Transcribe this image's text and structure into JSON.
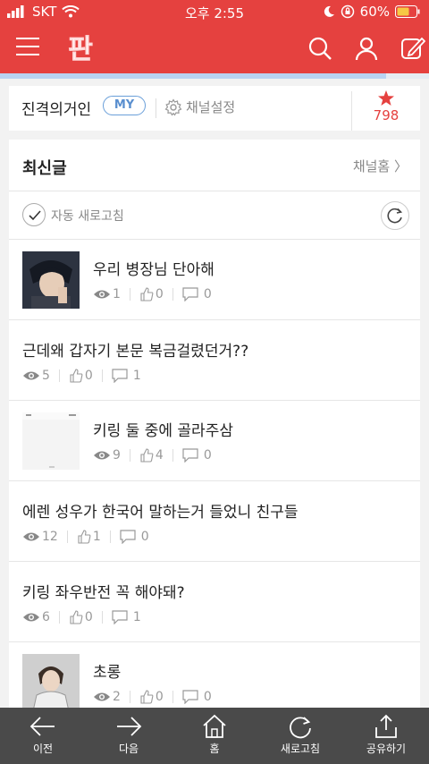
{
  "status_bar": {
    "carrier": "SKT",
    "time": "오후 2:55",
    "battery": "60%"
  },
  "app_bar": {
    "logo_text": "판"
  },
  "scroll_progress": 0.9,
  "channel": {
    "name": "진격의거인",
    "badge": "MY",
    "settings_label": "채널설정",
    "star_count": "798"
  },
  "feed": {
    "title": "최신글",
    "channel_home_label": "채널홈 〉",
    "auto_refresh_label": "자동 새로고침",
    "posts": [
      {
        "title": "우리 병장님 단아해",
        "views": "1",
        "likes": "0",
        "comments": "0",
        "has_thumb": true
      },
      {
        "title": "근데왜 갑자기 본문 복금걸렸던거??",
        "views": "5",
        "likes": "0",
        "comments": "1",
        "has_thumb": false
      },
      {
        "title": "키링 둘 중에 골라주삼",
        "views": "9",
        "likes": "4",
        "comments": "0",
        "has_thumb": true
      },
      {
        "title": "에렌 성우가 한국어 말하는거 들었니 친구들",
        "views": "12",
        "likes": "1",
        "comments": "0",
        "has_thumb": false
      },
      {
        "title": "키링 좌우반전 꼭 해야돼?",
        "views": "6",
        "likes": "0",
        "comments": "1",
        "has_thumb": false
      },
      {
        "title": "초롱",
        "views": "2",
        "likes": "0",
        "comments": "0",
        "has_thumb": true
      }
    ]
  },
  "bottom_nav": {
    "back": "이전",
    "forward": "다음",
    "home": "홈",
    "refresh": "새로고침",
    "share": "공유하기"
  },
  "colors": {
    "brand_red": "#e5413f",
    "accent_blue": "#5a8fcf",
    "bottom_bar": "#4a4a4a"
  }
}
